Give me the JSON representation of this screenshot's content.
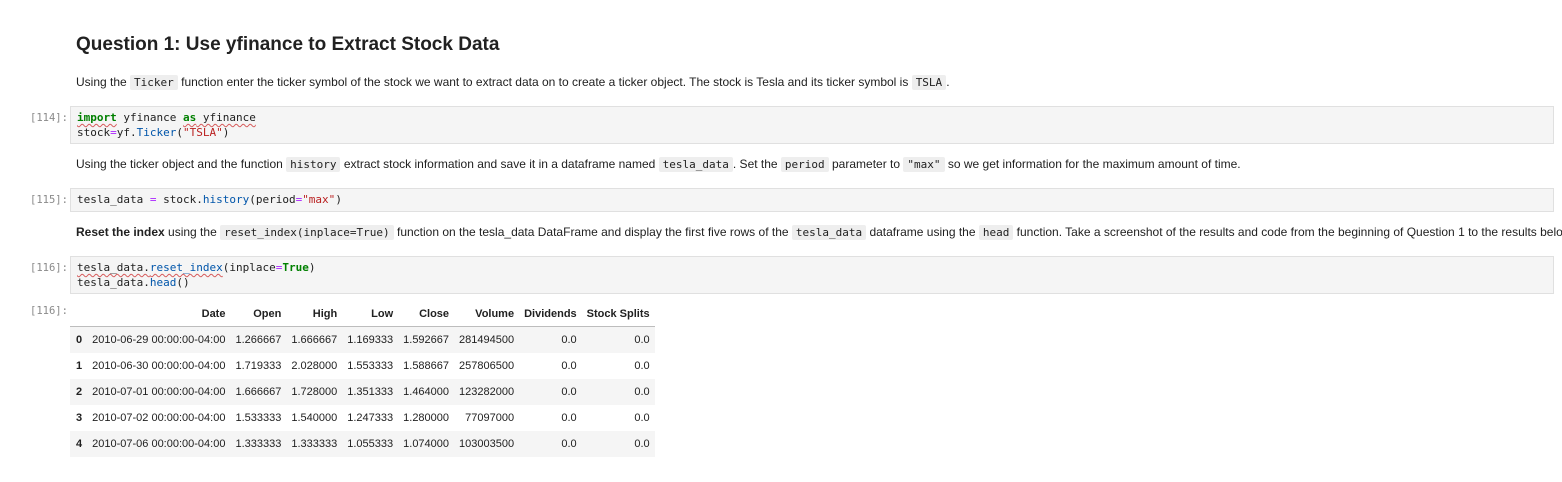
{
  "heading": "Question 1: Use yfinance to Extract Stock Data",
  "md1": {
    "t1": "Using the ",
    "c1": "Ticker",
    "t2": " function enter the ticker symbol of the stock we want to extract data on to create a ticker object. The stock is Tesla and its ticker symbol is ",
    "c2": "TSLA",
    "t3": "."
  },
  "cells": [
    {
      "prompt": "[114]:"
    },
    {
      "prompt": "[115]:"
    },
    {
      "prompt": "[116]:"
    }
  ],
  "cell114": {
    "import_kw": "import",
    "module": " yfinance ",
    "as_kw": "as",
    "alias": " yfinance",
    "l2a": "stock",
    "eq": "=",
    "l2b": "yf.",
    "l2c": "Ticker",
    "l2d": "(",
    "l2e": "\"TSLA\"",
    "l2f": ")"
  },
  "md2": {
    "t1": "Using the ticker object and the function ",
    "c1": "history",
    "t2": " extract stock information and save it in a dataframe named ",
    "c2": "tesla_data",
    "t3": ". Set the ",
    "c3": "period",
    "t4": " parameter to ",
    "c4": "\"max\"",
    "t5": " so we get information for the maximum amount of time."
  },
  "cell115": {
    "a": "tesla_data ",
    "eq": "=",
    "b": " stock.",
    "c": "history",
    "d": "(period",
    "eq2": "=",
    "e": "\"max\"",
    "f": ")"
  },
  "md3": {
    "b1": "Reset the index",
    "t1": " using the ",
    "c1": "reset_index(inplace=True)",
    "t2": " function on the tesla_data DataFrame and display the first five rows of the ",
    "c2": "tesla_data",
    "t3": " dataframe using the ",
    "c3": "head",
    "t4": " function. Take a screenshot of the results and code from the beginning of Question 1 to the results below."
  },
  "cell116": {
    "a": "tesla_data.",
    "b": "reset_index",
    "c": "(inplace",
    "eq": "=",
    "d": "True",
    "e": ")",
    "f": "tesla_data.",
    "g": "head",
    "h": "()"
  },
  "output_prompt": "[116]:",
  "table": {
    "columns": [
      "",
      "Date",
      "Open",
      "High",
      "Low",
      "Close",
      "Volume",
      "Dividends",
      "Stock Splits"
    ],
    "rows": [
      [
        "0",
        "2010-06-29 00:00:00-04:00",
        "1.266667",
        "1.666667",
        "1.169333",
        "1.592667",
        "281494500",
        "0.0",
        "0.0"
      ],
      [
        "1",
        "2010-06-30 00:00:00-04:00",
        "1.719333",
        "2.028000",
        "1.553333",
        "1.588667",
        "257806500",
        "0.0",
        "0.0"
      ],
      [
        "2",
        "2010-07-01 00:00:00-04:00",
        "1.666667",
        "1.728000",
        "1.351333",
        "1.464000",
        "123282000",
        "0.0",
        "0.0"
      ],
      [
        "3",
        "2010-07-02 00:00:00-04:00",
        "1.533333",
        "1.540000",
        "1.247333",
        "1.280000",
        "77097000",
        "0.0",
        "0.0"
      ],
      [
        "4",
        "2010-07-06 00:00:00-04:00",
        "1.333333",
        "1.333333",
        "1.055333",
        "1.074000",
        "103003500",
        "0.0",
        "0.0"
      ]
    ]
  }
}
